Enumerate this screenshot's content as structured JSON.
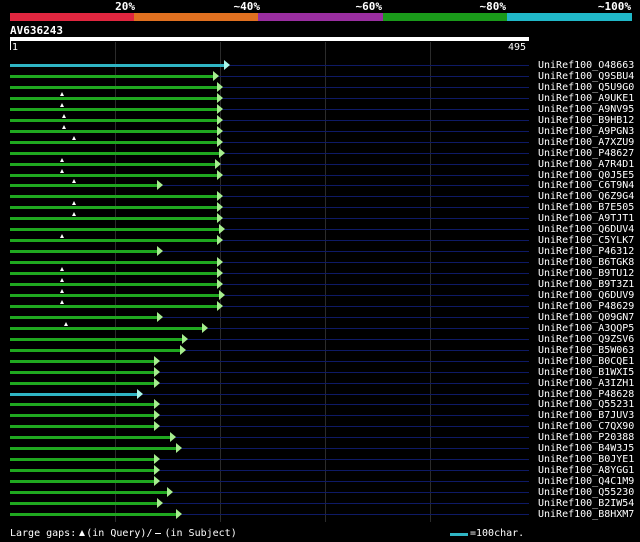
{
  "color_scale": {
    "labels": [
      "20%",
      "~40%",
      "~60%",
      "~80%",
      "~100%"
    ],
    "colors": [
      "#e0263f",
      "#e07020",
      "#9a2ea0",
      "#1a9a1a",
      "#20b8c8"
    ]
  },
  "query": {
    "name": "AV636243",
    "start": "1",
    "end": "495"
  },
  "colors": {
    "green": "#1fa81f",
    "cyan": "#2fb5c4",
    "arrow_green": "#a6ee8e",
    "arrow_cyan": "#a8f6e8",
    "line_blue": "#0e1a66"
  },
  "hits": [
    {
      "name": "UniRef100_O48663",
      "color": "cyan",
      "end": 227,
      "gap": null
    },
    {
      "name": "UniRef100_Q9SBU4",
      "color": "green",
      "end": 216,
      "gap": null
    },
    {
      "name": "UniRef100_Q5U9G0",
      "color": "green",
      "end": 220,
      "gap": null
    },
    {
      "name": "UniRef100_A9UKE1",
      "color": "green",
      "end": 220,
      "gap": 62
    },
    {
      "name": "UniRef100_A9NV95",
      "color": "green",
      "end": 220,
      "gap": 62
    },
    {
      "name": "UniRef100_B9HB12",
      "color": "green",
      "end": 220,
      "gap": 64
    },
    {
      "name": "UniRef100_A9PGN3",
      "color": "green",
      "end": 220,
      "gap": 64
    },
    {
      "name": "UniRef100_A7XZU9",
      "color": "green",
      "end": 220,
      "gap": 74
    },
    {
      "name": "UniRef100_P48627",
      "color": "green",
      "end": 222,
      "gap": null
    },
    {
      "name": "UniRef100_A7R4D1",
      "color": "green",
      "end": 218,
      "gap": 62
    },
    {
      "name": "UniRef100_Q0J5E5",
      "color": "green",
      "end": 220,
      "gap": 62
    },
    {
      "name": "UniRef100_C6T9N4",
      "color": "green",
      "end": 160,
      "gap": 74
    },
    {
      "name": "UniRef100_Q6Z9G4",
      "color": "green",
      "end": 220,
      "gap": null
    },
    {
      "name": "UniRef100_B7E505",
      "color": "green",
      "end": 220,
      "gap": 74
    },
    {
      "name": "UniRef100_A9TJT1",
      "color": "green",
      "end": 220,
      "gap": 74
    },
    {
      "name": "UniRef100_Q6DUV4",
      "color": "green",
      "end": 222,
      "gap": null
    },
    {
      "name": "UniRef100_C5YLK7",
      "color": "green",
      "end": 220,
      "gap": 62
    },
    {
      "name": "UniRef100_P46312",
      "color": "green",
      "end": 160,
      "gap": null
    },
    {
      "name": "UniRef100_B6TGK8",
      "color": "green",
      "end": 220,
      "gap": null
    },
    {
      "name": "UniRef100_B9TU12",
      "color": "green",
      "end": 220,
      "gap": 62
    },
    {
      "name": "UniRef100_B9T3Z1",
      "color": "green",
      "end": 220,
      "gap": 62
    },
    {
      "name": "UniRef100_Q6DUV9",
      "color": "green",
      "end": 222,
      "gap": 62
    },
    {
      "name": "UniRef100_P48629",
      "color": "green",
      "end": 220,
      "gap": 62
    },
    {
      "name": "UniRef100_Q09GN7",
      "color": "green",
      "end": 160,
      "gap": null
    },
    {
      "name": "UniRef100_A3QQP5",
      "color": "green",
      "end": 205,
      "gap": 66
    },
    {
      "name": "UniRef100_Q9ZSV6",
      "color": "green",
      "end": 185,
      "gap": null
    },
    {
      "name": "UniRef100_B5W063",
      "color": "green",
      "end": 183,
      "gap": null
    },
    {
      "name": "UniRef100_B0CQE1",
      "color": "green",
      "end": 157,
      "gap": null
    },
    {
      "name": "UniRef100_B1WXI5",
      "color": "green",
      "end": 157,
      "gap": null
    },
    {
      "name": "UniRef100_A3IZH1",
      "color": "green",
      "end": 157,
      "gap": null
    },
    {
      "name": "UniRef100_P48628",
      "color": "cyan",
      "end": 140,
      "gap": null
    },
    {
      "name": "UniRef100_Q55231",
      "color": "green",
      "end": 157,
      "gap": null
    },
    {
      "name": "UniRef100_B7JUV3",
      "color": "green",
      "end": 157,
      "gap": null
    },
    {
      "name": "UniRef100_C7QX90",
      "color": "green",
      "end": 157,
      "gap": null
    },
    {
      "name": "UniRef100_P20388",
      "color": "green",
      "end": 173,
      "gap": null
    },
    {
      "name": "UniRef100_B4W3J5",
      "color": "green",
      "end": 179,
      "gap": null
    },
    {
      "name": "UniRef100_B0JYE1",
      "color": "green",
      "end": 157,
      "gap": null
    },
    {
      "name": "UniRef100_A8YGG1",
      "color": "green",
      "end": 157,
      "gap": null
    },
    {
      "name": "UniRef100_Q4C1M9",
      "color": "green",
      "end": 157,
      "gap": null
    },
    {
      "name": "UniRef100_Q55230",
      "color": "green",
      "end": 170,
      "gap": null
    },
    {
      "name": "UniRef100_B2IW54",
      "color": "green",
      "end": 160,
      "gap": null
    },
    {
      "name": "UniRef100_B8HXM7",
      "color": "green",
      "end": 179,
      "gap": null
    }
  ],
  "legend": {
    "large_gaps": "Large gaps:",
    "in_query": "(in Query)/",
    "in_subject": "(in Subject)",
    "scale": "=100char."
  }
}
